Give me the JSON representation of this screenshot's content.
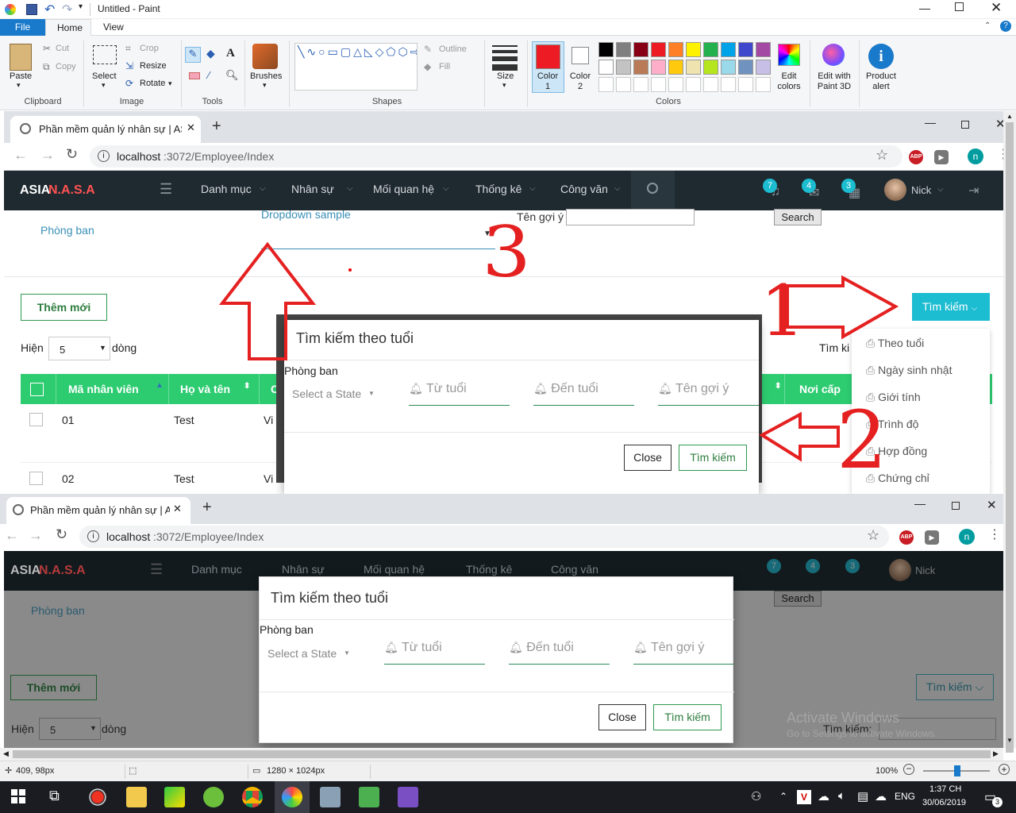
{
  "paint": {
    "title": "Untitled - Paint",
    "tabs": [
      "File",
      "Home",
      "View"
    ],
    "clipboard": {
      "paste": "Paste",
      "cut": "Cut",
      "copy": "Copy",
      "label": "Clipboard"
    },
    "image": {
      "select": "Select",
      "crop": "Crop",
      "resize": "Resize",
      "rotate": "Rotate",
      "label": "Image"
    },
    "tools_label": "Tools",
    "brushes": "Brushes",
    "shapes": {
      "outline": "Outline",
      "fill": "Fill",
      "label": "Shapes"
    },
    "size": "Size",
    "color1": "Color 1",
    "color2": "Color 2",
    "colors_label": "Colors",
    "edit_colors": "Edit colors",
    "paint3d": "Edit with Paint 3D",
    "product_alert": "Product alert",
    "palette": [
      "#000000",
      "#7f7f7f",
      "#880015",
      "#ed1c24",
      "#ff7f27",
      "#fff200",
      "#22b14c",
      "#00a2e8",
      "#3f48cc",
      "#a349a4",
      "#ffffff",
      "#c3c3c3",
      "#b97a57",
      "#ffaec9",
      "#ffc90e",
      "#efe4b0",
      "#b5e61d",
      "#99d9ea",
      "#7092be",
      "#c8bfe7"
    ],
    "status_pos": "409, 98px",
    "status_size": "1280 × 1024px",
    "zoom": "100%"
  },
  "browser1": {
    "tab_title": "Phần mềm quản lý nhân sự | ASI/",
    "url_host": "localhost",
    "url_path": ":3072/Employee/Index",
    "profile_initial": "n"
  },
  "app": {
    "brand_a": "ASIA",
    "brand_b": "N.A.S.A",
    "menu": [
      "Danh mục",
      "Nhân sự",
      "Mối quan hệ",
      "Thống kê",
      "Công văn"
    ],
    "badges": [
      "7",
      "4",
      "3"
    ],
    "user": "Nick",
    "phong_ban": "Phòng ban",
    "dropdown_sample": "Dropdown sample",
    "ten_goi_y": "Tên gợi ý",
    "search_btn": "Search",
    "them_moi": "Thêm mới",
    "hien": "Hiện",
    "page_size": "5",
    "dong": "dòng",
    "tim_kiem": "Tìm kiếm",
    "tim_ki_partial": "Tìm ki",
    "tim_kiem_label": "Tìm kiếm:",
    "columns": [
      "Mã nhân viên",
      "Họ và tên",
      "C",
      "Nơi cấp"
    ],
    "rows": [
      {
        "id": "01",
        "name": "Test",
        "c": "Vi"
      },
      {
        "id": "02",
        "name": "Test",
        "c": "Vi"
      }
    ],
    "search_menu": [
      "Theo tuổi",
      "Ngày sinh nhật",
      "Giới tính",
      "Trình độ",
      "Hợp đồng",
      "Chứng chỉ"
    ]
  },
  "modal": {
    "title": "Tìm kiếm theo tuổi",
    "phong_ban": "Phòng ban",
    "select_placeholder": "Select a State",
    "from_age": "Từ tuổi",
    "to_age": "Đến tuổi",
    "hint": "Tên gợi ý",
    "close": "Close",
    "submit": "Tìm kiếm"
  },
  "annotations": [
    "3",
    "1",
    "2"
  ],
  "watermark": {
    "line1": "Activate Windows",
    "line2": "Go to Settings to activate Windows."
  },
  "taskbar": {
    "lang": "ENG",
    "time": "1:37 CH",
    "date": "30/06/2019",
    "notif": "3"
  }
}
